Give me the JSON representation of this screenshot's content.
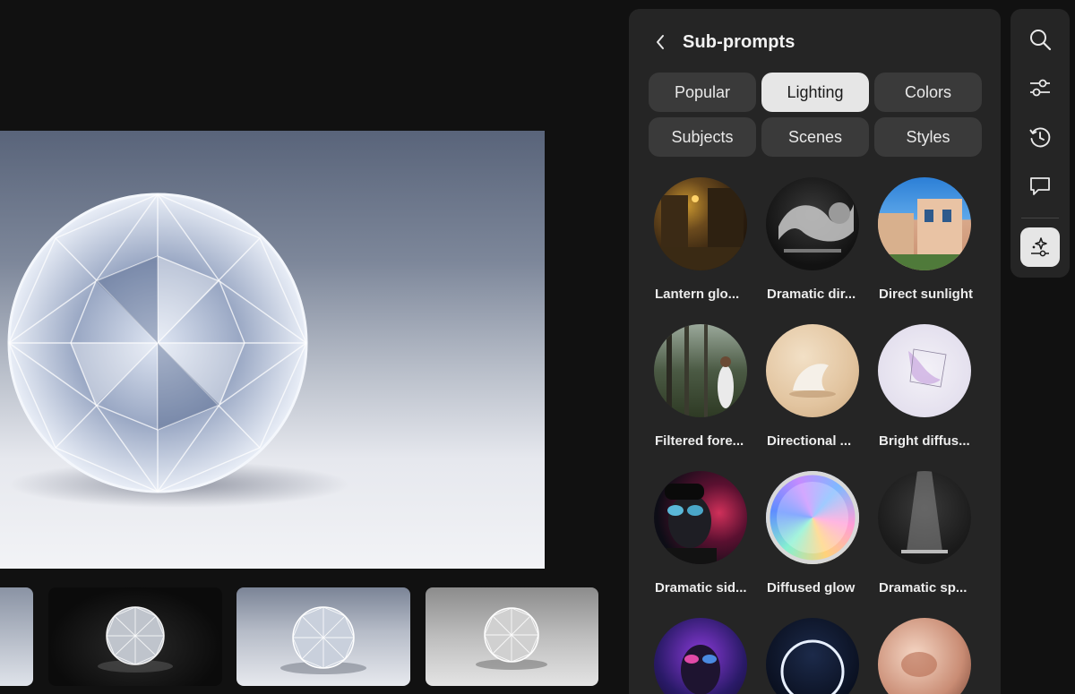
{
  "panel": {
    "title": "Sub-prompts",
    "back_icon": "chevron-left-icon",
    "tabs": [
      {
        "label": "Popular",
        "active": false
      },
      {
        "label": "Lighting",
        "active": true
      },
      {
        "label": "Colors",
        "active": false
      },
      {
        "label": "Subjects",
        "active": false
      },
      {
        "label": "Scenes",
        "active": false
      },
      {
        "label": "Styles",
        "active": false
      }
    ],
    "items": [
      {
        "label": "Lantern glo..."
      },
      {
        "label": "Dramatic dir..."
      },
      {
        "label": "Direct sunlight"
      },
      {
        "label": "Filtered fore..."
      },
      {
        "label": "Directional ..."
      },
      {
        "label": "Bright diffus..."
      },
      {
        "label": "Dramatic sid..."
      },
      {
        "label": "Diffused glow",
        "selected": true
      },
      {
        "label": "Dramatic sp..."
      },
      {
        "label": ""
      },
      {
        "label": ""
      },
      {
        "label": ""
      }
    ]
  },
  "rail": {
    "buttons": [
      {
        "icon": "search-icon",
        "active": false
      },
      {
        "icon": "sliders-icon",
        "active": false
      },
      {
        "icon": "history-icon",
        "active": false
      },
      {
        "icon": "comment-icon",
        "active": false
      },
      {
        "icon": "sparkle-adjust-icon",
        "active": true
      }
    ]
  },
  "colors": {
    "background": "#111111",
    "panel": "#252525",
    "tab": "#3a3a3a",
    "tab_active": "#e6e6e6"
  }
}
